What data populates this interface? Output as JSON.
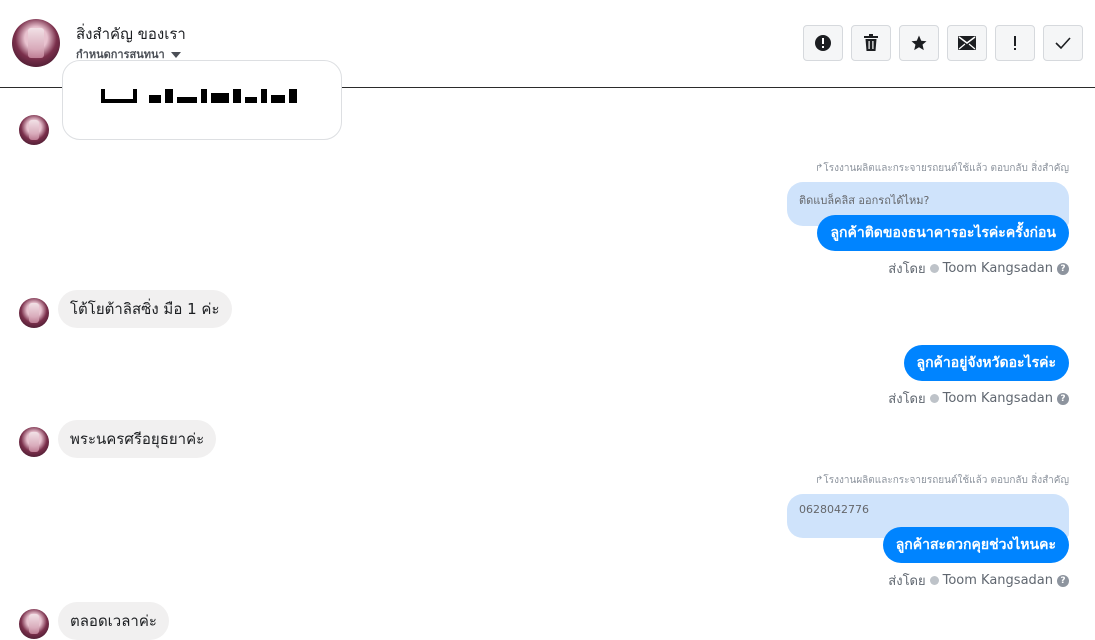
{
  "header": {
    "title": "สิ่งสำคัญ ของเรา",
    "subtitle": "กำหนดการสนทนา",
    "toolbar": [
      {
        "name": "report-button",
        "icon": "alert-circle-icon",
        "glyph": "!"
      },
      {
        "name": "delete-button",
        "icon": "trash-icon",
        "glyph": "🗑"
      },
      {
        "name": "star-button",
        "icon": "star-icon",
        "glyph": "★"
      },
      {
        "name": "mail-button",
        "icon": "envelope-icon",
        "glyph": "✉"
      },
      {
        "name": "important-button",
        "icon": "exclamation-icon",
        "glyph": "!"
      },
      {
        "name": "done-button",
        "icon": "check-icon",
        "glyph": "✓"
      }
    ]
  },
  "messages": {
    "reply_note_1": "โรงงานผลิตและกระจายรถยนต์ใช้แล้ว ตอบกลับ สิ่งสำคัญ",
    "quote_1": "ติดแบล็คลิส ออกรถได้ไหม?",
    "out_1": "ลูกค้าติดของธนาคารอะไรค่ะครั้งก่อน",
    "in_1": "โต้โยต้าลิสซิ่ง มือ 1 ค่ะ",
    "out_2": "ลูกค้าอยู่จังหวัดอะไรค่ะ",
    "in_2": "พระนครศรีอยุธยาค่ะ",
    "reply_note_2": "โรงงานผลิตและกระจายรถยนต์ใช้แล้ว ตอบกลับ สิ่งสำคัญ",
    "quote_2": "0628042776",
    "out_3": "ลูกค้าสะดวกคุยช่วงไหนคะ",
    "in_3": "ตลอดเวลาค่ะ",
    "sent_by_label": "ส่งโดย",
    "sender_name": "Toom Kangsadan"
  },
  "colors": {
    "outgoing_bubble": "#0084ff",
    "incoming_bubble": "#f1f0f0",
    "quote_bubble": "#cfe3fb"
  }
}
